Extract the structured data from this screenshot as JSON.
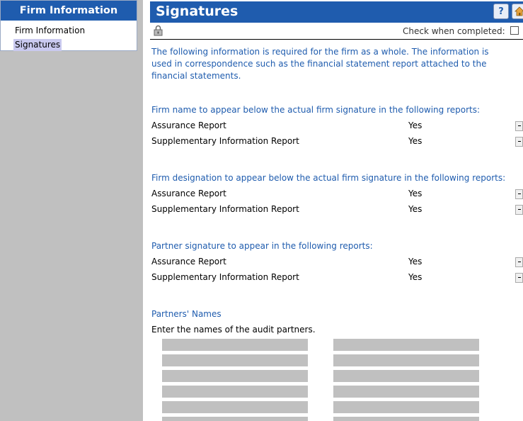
{
  "nav": {
    "header": "Firm Information",
    "items": [
      {
        "label": "Firm Information",
        "selected": false
      },
      {
        "label": "Signatures",
        "selected": true
      }
    ]
  },
  "header": {
    "title": "Signatures",
    "help_icon": "help-icon",
    "home_icon": "home-icon",
    "lock_icon": "lock-icon"
  },
  "completion": {
    "label": "Check when completed:",
    "checked": false
  },
  "intro": "The following information is required for the firm as a whole.  The information is used in correspondence such as  the financial statement report attached to the financial statements.",
  "sections": [
    {
      "heading": "Firm name to appear below the actual firm signature in the following reports:",
      "rows": [
        {
          "label": "Assurance Report",
          "value": "Yes"
        },
        {
          "label": "Supplementary Information Report",
          "value": "Yes"
        }
      ]
    },
    {
      "heading": "Firm designation to appear below the actual firm signature in the following reports:",
      "rows": [
        {
          "label": "Assurance Report",
          "value": "Yes"
        },
        {
          "label": "Supplementary Information Report",
          "value": "Yes"
        }
      ]
    },
    {
      "heading": "Partner signature to appear in the following reports:",
      "rows": [
        {
          "label": "Assurance Report",
          "value": "Yes"
        },
        {
          "label": "Supplementary Information Report",
          "value": "Yes"
        }
      ]
    }
  ],
  "partners": {
    "heading": "Partners' Names",
    "instruction": "Enter the names of the audit partners.",
    "fields_left": [
      "",
      "",
      "",
      "",
      "",
      ""
    ],
    "fields_right": [
      "",
      "",
      "",
      "",
      "",
      ""
    ]
  },
  "colors": {
    "accent": "#1f5cae",
    "selected_bg": "#c9c9ef",
    "field_bg": "#c0c0c0"
  }
}
